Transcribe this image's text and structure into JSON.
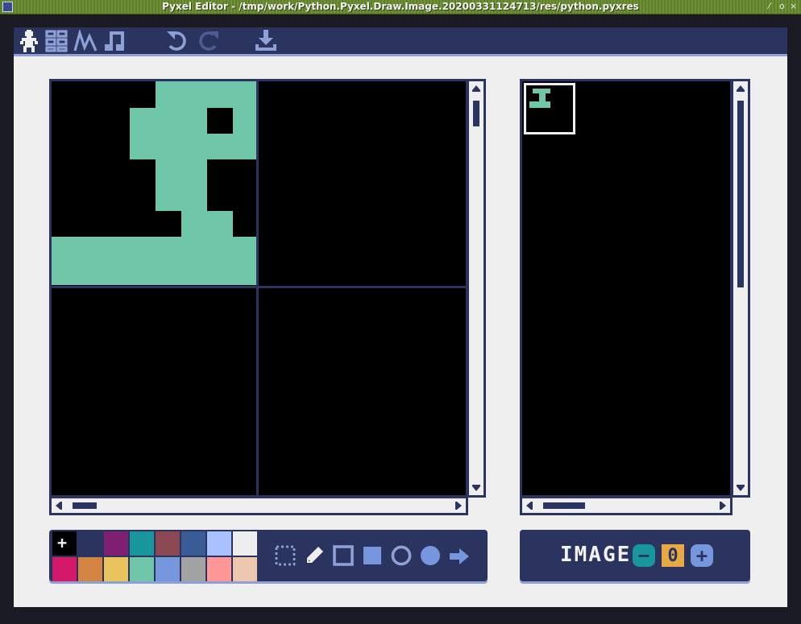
{
  "window": {
    "title": "Pyxel Editor - /tmp/work/Python.Pyxel.Draw.Image.20200331124713/res/python.pyxres",
    "controls": [
      "⁄",
      "o",
      "×"
    ]
  },
  "toolbar": {
    "editors": [
      "image-editor-icon",
      "tilemap-editor-icon",
      "sound-editor-icon",
      "music-editor-icon"
    ],
    "actions": [
      "undo-icon",
      "redo-icon",
      "save-icon"
    ]
  },
  "colors": {
    "navy": "#2b335f",
    "light": "#8ea0d6",
    "teal": "#6fc6a9",
    "bg": "#efefef"
  },
  "palette": [
    "#000000",
    "#2b335f",
    "#7e2072",
    "#19959c",
    "#8b4852",
    "#395c98",
    "#a9c1ff",
    "#eeeeee",
    "#d4186c",
    "#d38441",
    "#e9c35b",
    "#70c6a9",
    "#7696de",
    "#a3a3a3",
    "#ff9798",
    "#edc7b0"
  ],
  "tools": [
    "select-icon",
    "pencil-icon",
    "rect-outline-icon",
    "rect-fill-icon",
    "circle-outline-icon",
    "circle-fill-icon",
    "bucket-icon"
  ],
  "image_panel": {
    "label": "IMAGE",
    "number": "0",
    "minus": "−",
    "plus": "+"
  },
  "brush_add": "+"
}
